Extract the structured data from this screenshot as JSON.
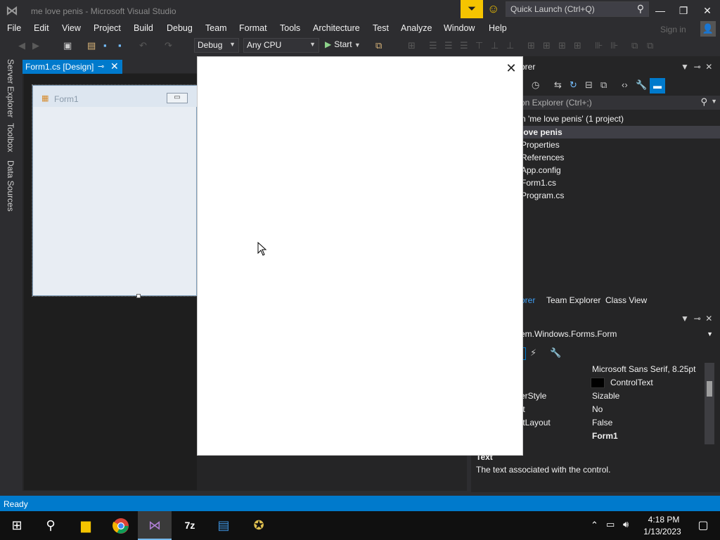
{
  "window": {
    "title": "me love penis - Microsoft Visual Studio",
    "quick_launch_placeholder": "Quick Launch (Ctrl+Q)",
    "minimize": "—",
    "restore": "❐",
    "close": "✕"
  },
  "menu": [
    "File",
    "Edit",
    "View",
    "Project",
    "Build",
    "Debug",
    "Team",
    "Format",
    "Tools",
    "Architecture",
    "Test",
    "Analyze",
    "Window",
    "Help"
  ],
  "account": {
    "signin_label": "Sign in"
  },
  "toolbar": {
    "config": "Debug",
    "platform": "Any CPU",
    "start_label": "Start"
  },
  "left_rail": [
    "Server Explorer",
    "Toolbox",
    "Data Sources"
  ],
  "document_tab": {
    "label": "Form1.cs [Design]",
    "pin": "⊸",
    "close": "✕"
  },
  "designer": {
    "form_title": "Form1"
  },
  "solution_explorer": {
    "header": "orer",
    "search_placeholder": "on Explorer (Ctrl+;)",
    "items": [
      {
        "label": "n 'me love penis' (1 project)"
      },
      {
        "label": "love penis",
        "selected": true
      },
      {
        "label": "Properties"
      },
      {
        "label": "References"
      },
      {
        "label": "App.config"
      },
      {
        "label": "Form1.cs"
      },
      {
        "label": "Program.cs"
      }
    ],
    "bottom_tabs": [
      "orer",
      "Team Explorer",
      "Class View"
    ]
  },
  "properties": {
    "object": "em.Windows.Forms.Form",
    "rows": [
      {
        "name": "",
        "value": "Microsoft Sans Serif, 8.25pt"
      },
      {
        "name": "",
        "value": "ControlText",
        "swatch": "#000000"
      },
      {
        "name": "erStyle",
        "value": "Sizable"
      },
      {
        "name": "ft",
        "value": "No"
      },
      {
        "name": "ftLayout",
        "value": "False"
      },
      {
        "name": "",
        "value": "Form1",
        "bold": true
      }
    ],
    "description_title": "Text",
    "description_text": "The text associated with the control."
  },
  "popup": {
    "close": "✕"
  },
  "status": {
    "text": "Ready"
  },
  "taskbar": {
    "time": "4:18 PM",
    "date": "1/13/2023"
  },
  "colors": {
    "accent": "#007acc",
    "background": "#2d2d30",
    "popup_bg": "#ffffff",
    "filter_button": "#f5c400"
  }
}
